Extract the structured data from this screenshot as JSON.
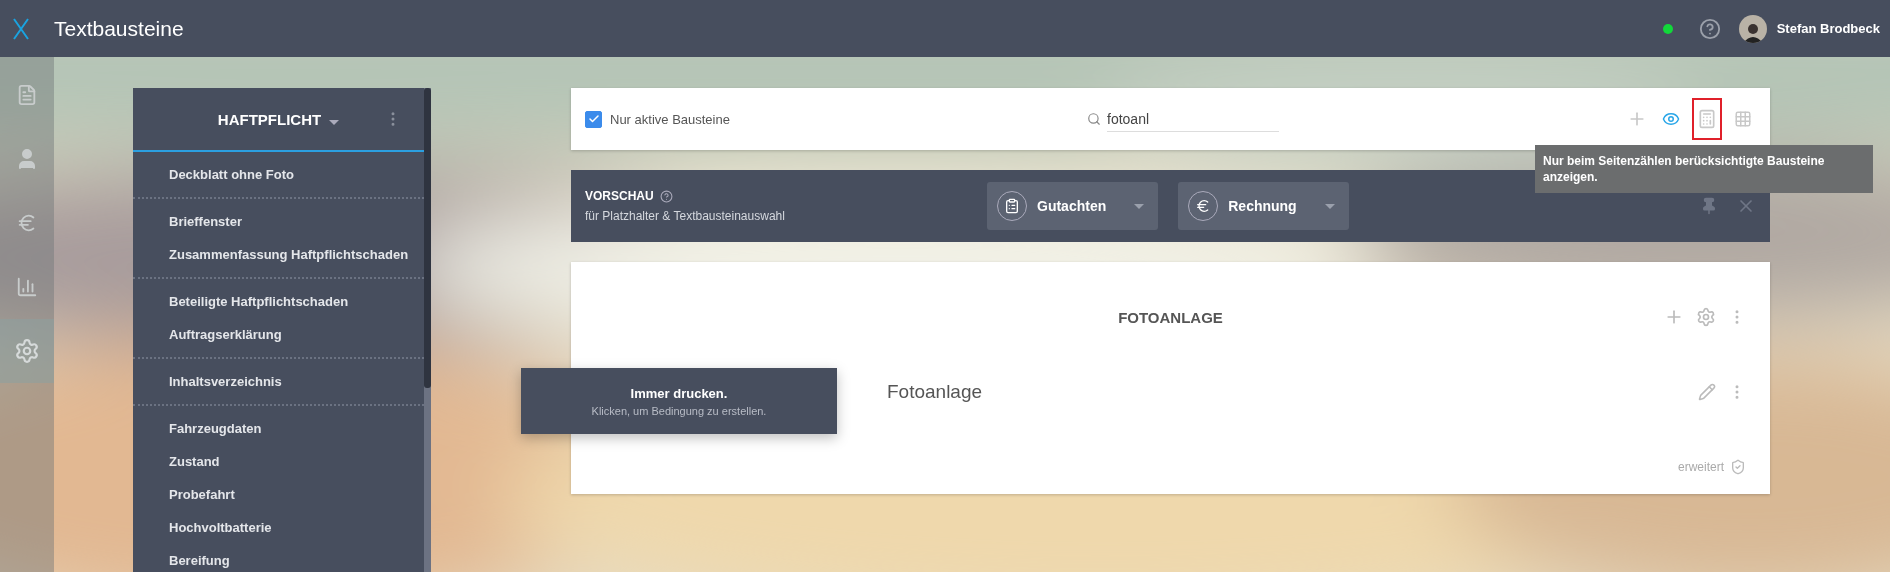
{
  "app": {
    "title": "Textbausteine",
    "online": true,
    "user": "Stefan Brodbeck"
  },
  "nav": [
    {
      "kind": "document",
      "selected": false
    },
    {
      "kind": "person",
      "selected": false
    },
    {
      "kind": "euro",
      "selected": false
    },
    {
      "kind": "chart",
      "selected": false
    },
    {
      "kind": "settings",
      "selected": true
    }
  ],
  "sidebar": {
    "title": "HAFTPFLICHT",
    "groups": [
      {
        "items": [
          "Deckblatt ohne Foto"
        ]
      },
      {
        "items": [
          "Brieffenster",
          "Zusammenfassung Haftpflichtschaden"
        ]
      },
      {
        "items": [
          "Beteiligte Haftpflichtschaden",
          "Auftragserklärung"
        ]
      },
      {
        "items": [
          "Inhaltsverzeichnis"
        ]
      },
      {
        "items": [
          "Fahrzeugdaten",
          "Zustand",
          "Probefahrt",
          "Hochvoltbatterie",
          "Bereifung"
        ]
      }
    ]
  },
  "toolbar": {
    "filter": {
      "label": "Nur aktive Bausteine",
      "checked": true
    },
    "search": {
      "value": "fotoanl"
    },
    "tools": [
      {
        "kind": "add",
        "on": false,
        "highlighted": false
      },
      {
        "kind": "preview",
        "on": true,
        "highlighted": false
      },
      {
        "kind": "count",
        "on": false,
        "highlighted": true
      },
      {
        "kind": "grid",
        "on": false,
        "highlighted": false
      }
    ],
    "tooltip": "Nur beim Seitenzählen berücksichtigte Bausteine anzeigen."
  },
  "preview": {
    "title": "VORSCHAU",
    "subtitle": "für Platzhalter & Textbausteinauswahl",
    "selects": [
      {
        "kind": "report",
        "label": "Gutachten"
      },
      {
        "kind": "invoice",
        "label": "Rechnung"
      }
    ]
  },
  "section": {
    "title": "FOTOANLAGE",
    "items": [
      "Fotoanlage"
    ],
    "footer": "erweitert"
  },
  "popup": {
    "title": "Immer drucken.",
    "hint": "Klicken, um Bedingung zu erstellen."
  }
}
